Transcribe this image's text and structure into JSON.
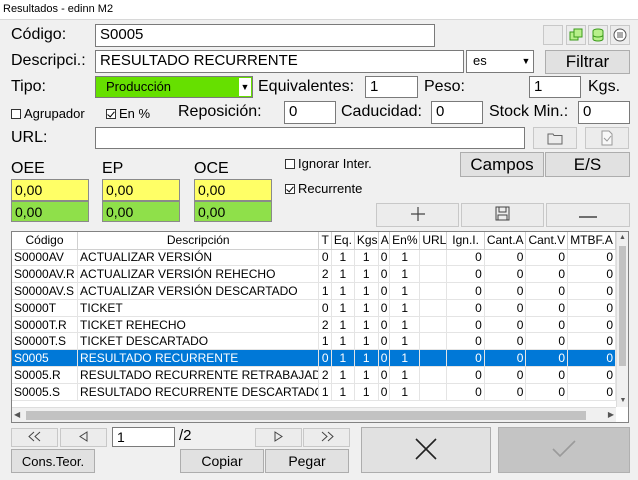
{
  "window": {
    "title": "Resultados - edinn M2"
  },
  "form": {
    "codigo_label": "Código:",
    "codigo_value": "S0005",
    "descripcion_label": "Descripci.:",
    "descripcion_value": "RESULTADO RECURRENTE",
    "lang_value": "es",
    "filtrar_label": "Filtrar",
    "tipo_label": "Tipo:",
    "tipo_value": "Producción",
    "equivalentes_label": "Equivalentes:",
    "equivalentes_value": "1",
    "peso_label": "Peso:",
    "peso_value": "1",
    "kgs_label": "Kgs.",
    "agrupador_label": "Agrupador",
    "agrupador_checked": false,
    "enpct_label": "En %",
    "enpct_checked": true,
    "reposicion_label": "Reposición:",
    "reposicion_value": "0",
    "caducidad_label": "Caducidad:",
    "caducidad_value": "0",
    "stockmin_label": "Stock Min.:",
    "stockmin_value": "0",
    "url_label": "URL:",
    "url_value": ""
  },
  "metrics": {
    "oee_label": "OEE",
    "ep_label": "EP",
    "oce_label": "OCE",
    "oee_top": "0,00",
    "oee_bottom": "0,00",
    "ep_top": "0,00",
    "ep_bottom": "0,00",
    "oce_top": "0,00",
    "oce_bottom": "0,00",
    "ignorar_label": "Ignorar Inter.",
    "ignorar_checked": false,
    "recurrente_label": "Recurrente",
    "recurrente_checked": true,
    "campos_label": "Campos",
    "es_label": "E/S"
  },
  "grid": {
    "columns": [
      "Código",
      "Descripción",
      "T",
      "Eq.",
      "Kgs",
      "A",
      "En%",
      "URL",
      "Ign.I.",
      "Cant.A",
      "Cant.V",
      "MTBF.A"
    ],
    "rows": [
      [
        "S0000AV",
        "ACTUALIZAR VERSIÓN",
        "0",
        "1",
        "1",
        "0",
        "1",
        "",
        "0",
        "0",
        "0",
        "0"
      ],
      [
        "S0000AV.R",
        "ACTUALIZAR VERSIÓN REHECHO",
        "2",
        "1",
        "1",
        "0",
        "1",
        "",
        "0",
        "0",
        "0",
        "0"
      ],
      [
        "S0000AV.S",
        "ACTUALIZAR VERSIÓN DESCARTADO",
        "1",
        "1",
        "1",
        "0",
        "1",
        "",
        "0",
        "0",
        "0",
        "0"
      ],
      [
        "S0000T",
        "TICKET",
        "0",
        "1",
        "1",
        "0",
        "1",
        "",
        "0",
        "0",
        "0",
        "0"
      ],
      [
        "S0000T.R",
        "TICKET REHECHO",
        "2",
        "1",
        "1",
        "0",
        "1",
        "",
        "0",
        "0",
        "0",
        "0"
      ],
      [
        "S0000T.S",
        "TICKET DESCARTADO",
        "1",
        "1",
        "1",
        "0",
        "1",
        "",
        "0",
        "0",
        "0",
        "0"
      ],
      [
        "S0005",
        "RESULTADO RECURRENTE",
        "0",
        "1",
        "1",
        "0",
        "1",
        "",
        "0",
        "0",
        "0",
        "0"
      ],
      [
        "S0005.R",
        "RESULTADO RECURRENTE RETRABAJADO",
        "2",
        "1",
        "1",
        "0",
        "1",
        "",
        "0",
        "0",
        "0",
        "0"
      ],
      [
        "S0005.S",
        "RESULTADO RECURRENTE DESCARTADO",
        "1",
        "1",
        "1",
        "0",
        "1",
        "",
        "0",
        "0",
        "0",
        "0"
      ]
    ],
    "selected_index": 6
  },
  "pager": {
    "page_value": "1",
    "total_label": "/2"
  },
  "footer": {
    "cons_teor_label": "Cons.Teor.",
    "copiar_label": "Copiar",
    "pegar_label": "Pegar"
  },
  "colors": {
    "tipo_bg": "#66e000",
    "yellow": "#ffff66",
    "green": "#8fe04a",
    "selection": "#0078d7"
  }
}
